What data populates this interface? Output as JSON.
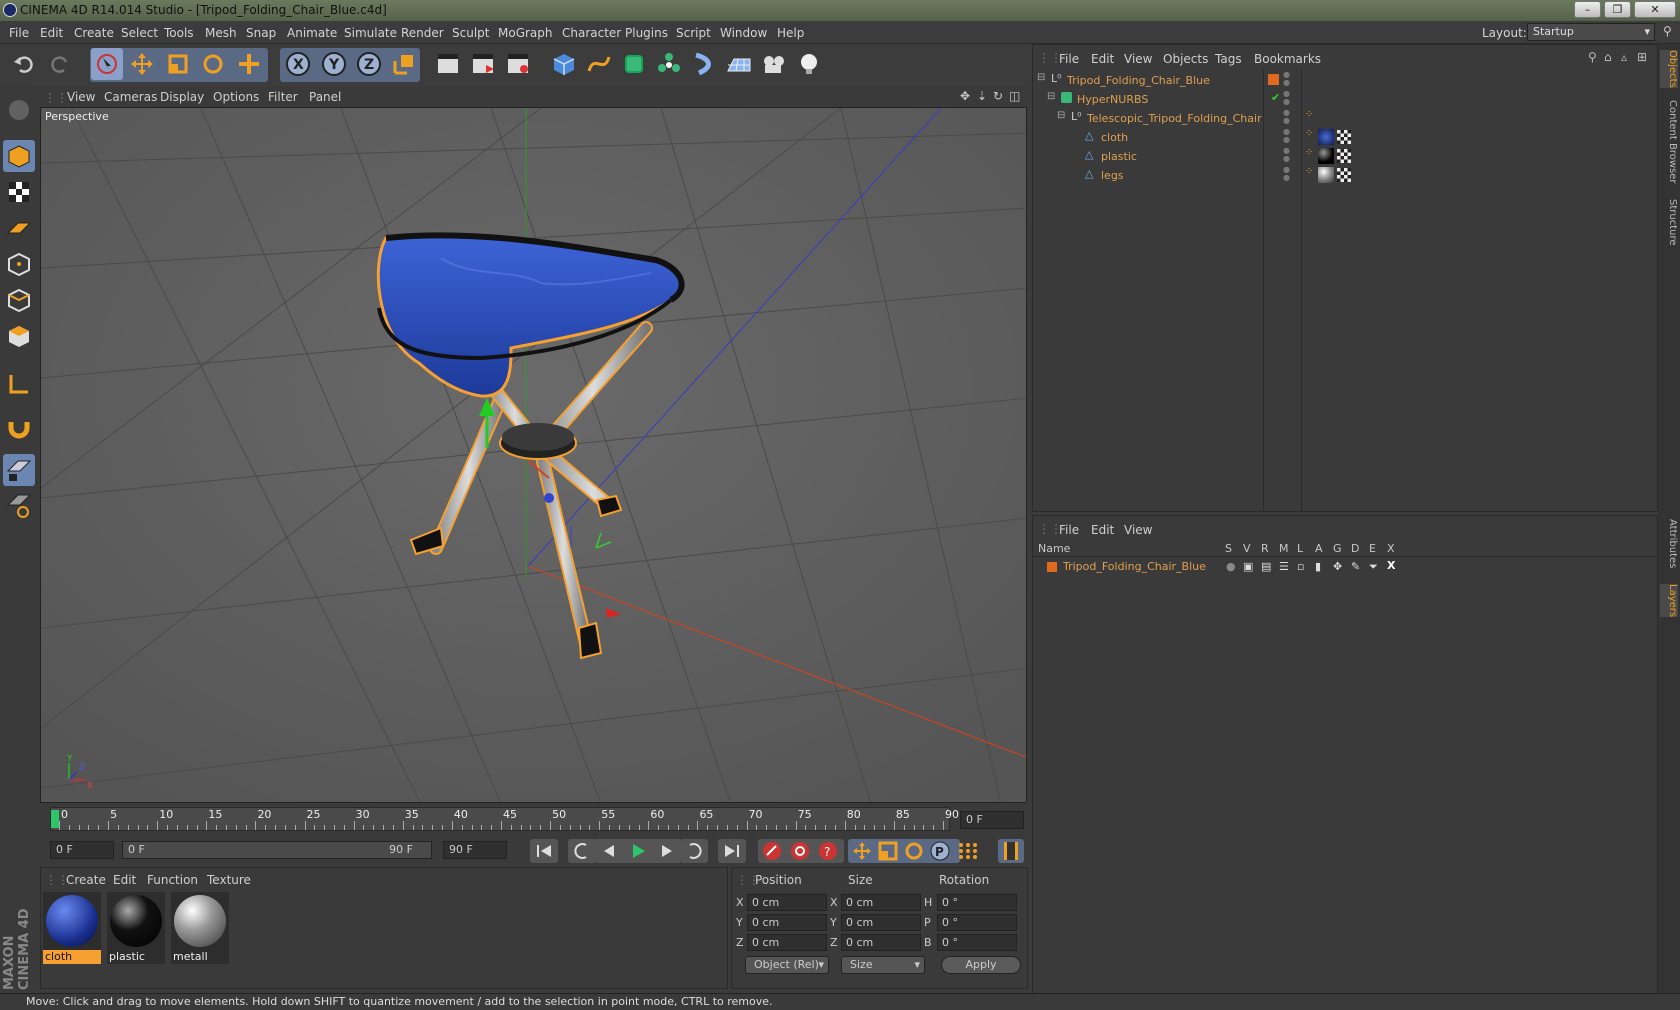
{
  "window": {
    "title": "CINEMA 4D R14.014 Studio - [Tripod_Folding_Chair_Blue.c4d]",
    "buttons": [
      "–",
      "❐",
      "✕"
    ]
  },
  "menubar": {
    "items": [
      "File",
      "Edit",
      "Create",
      "Select",
      "Tools",
      "Mesh",
      "Snap",
      "Animate",
      "Simulate",
      "Render",
      "Sculpt",
      "MoGraph",
      "Character",
      "Plugins",
      "Script",
      "Window",
      "Help"
    ],
    "layout_label": "Layout:",
    "layout_value": "Startup"
  },
  "toolbar": {
    "icons": [
      "undo-icon",
      "redo-icon",
      "live-select-icon",
      "move-icon",
      "scale-icon",
      "rotate-icon",
      "add-object-icon",
      "x-axis-lock-icon",
      "y-axis-lock-icon",
      "z-axis-lock-icon",
      "world-coordinates-icon",
      "render-view-icon",
      "render-picture-viewer-icon",
      "render-settings-icon",
      "cube-icon",
      "spline-icon",
      "nurbs-icon",
      "array-icon",
      "deformer-icon",
      "floor-icon",
      "camera-icon",
      "light-icon"
    ]
  },
  "viewport": {
    "menu": [
      "View",
      "Cameras",
      "Display",
      "Options",
      "Filter",
      "Panel"
    ],
    "label": "Perspective",
    "axis_labels": {
      "x": "X",
      "y": "Y",
      "z": "Z"
    }
  },
  "timeline": {
    "ticks": [
      "0",
      "5",
      "10",
      "15",
      "20",
      "25",
      "30",
      "35",
      "40",
      "45",
      "50",
      "55",
      "60",
      "65",
      "70",
      "75",
      "80",
      "85",
      "90"
    ],
    "current_frame": "0 F"
  },
  "anim": {
    "start": "0 F",
    "range_left": "0 F",
    "range_right": "90 F",
    "end": "90 F"
  },
  "material_panel": {
    "menu": [
      "Create",
      "Edit",
      "Function",
      "Texture"
    ],
    "materials": [
      {
        "name": "cloth",
        "selected": true
      },
      {
        "name": "plastic",
        "selected": false
      },
      {
        "name": "metall",
        "selected": false
      }
    ]
  },
  "coords": {
    "headers": {
      "position": "Position",
      "size": "Size",
      "rotation": "Rotation"
    },
    "rows": [
      {
        "axis": "X",
        "pos": "0 cm",
        "size_axis": "X",
        "size": "0 cm",
        "rot_axis": "H",
        "rot": "0 °"
      },
      {
        "axis": "Y",
        "pos": "0 cm",
        "size_axis": "Y",
        "size": "0 cm",
        "rot_axis": "P",
        "rot": "0 °"
      },
      {
        "axis": "Z",
        "pos": "0 cm",
        "size_axis": "Z",
        "size": "0 cm",
        "rot_axis": "B",
        "rot": "0 °"
      }
    ],
    "mode": "Object (Rel)",
    "size_mode": "Size",
    "apply": "Apply"
  },
  "object_manager": {
    "menu": [
      "File",
      "Edit",
      "View",
      "Objects",
      "Tags",
      "Bookmarks"
    ],
    "objects": [
      {
        "name": "Tripod_Folding_Chair_Blue",
        "indent": 0
      },
      {
        "name": "HyperNURBS",
        "indent": 1
      },
      {
        "name": "Telescopic_Tripod_Folding_Chair",
        "indent": 2
      },
      {
        "name": "cloth",
        "indent": 3
      },
      {
        "name": "plastic",
        "indent": 3
      },
      {
        "name": "legs",
        "indent": 3
      }
    ]
  },
  "layer_manager": {
    "menu": [
      "File",
      "Edit",
      "View"
    ],
    "columns": [
      "Name",
      "S",
      "V",
      "R",
      "M",
      "L",
      "A",
      "G",
      "D",
      "E",
      "X"
    ],
    "layers": [
      {
        "name": "Tripod_Folding_Chair_Blue"
      }
    ]
  },
  "side_tabs": [
    "Objects",
    "Content Browser",
    "Structure",
    "Attributes",
    "Layers"
  ],
  "status": "Move: Click and drag to move elements. Hold down SHIFT to quantize movement / add to the selection in point mode, CTRL to remove.",
  "logo": {
    "text": "MAXON CINEMA 4D"
  },
  "colors": {
    "accent": "#6b86b0",
    "object_name": "#e0a050",
    "cloth_blue": "#2a4fb5",
    "selection_orange": "#f5a030"
  }
}
